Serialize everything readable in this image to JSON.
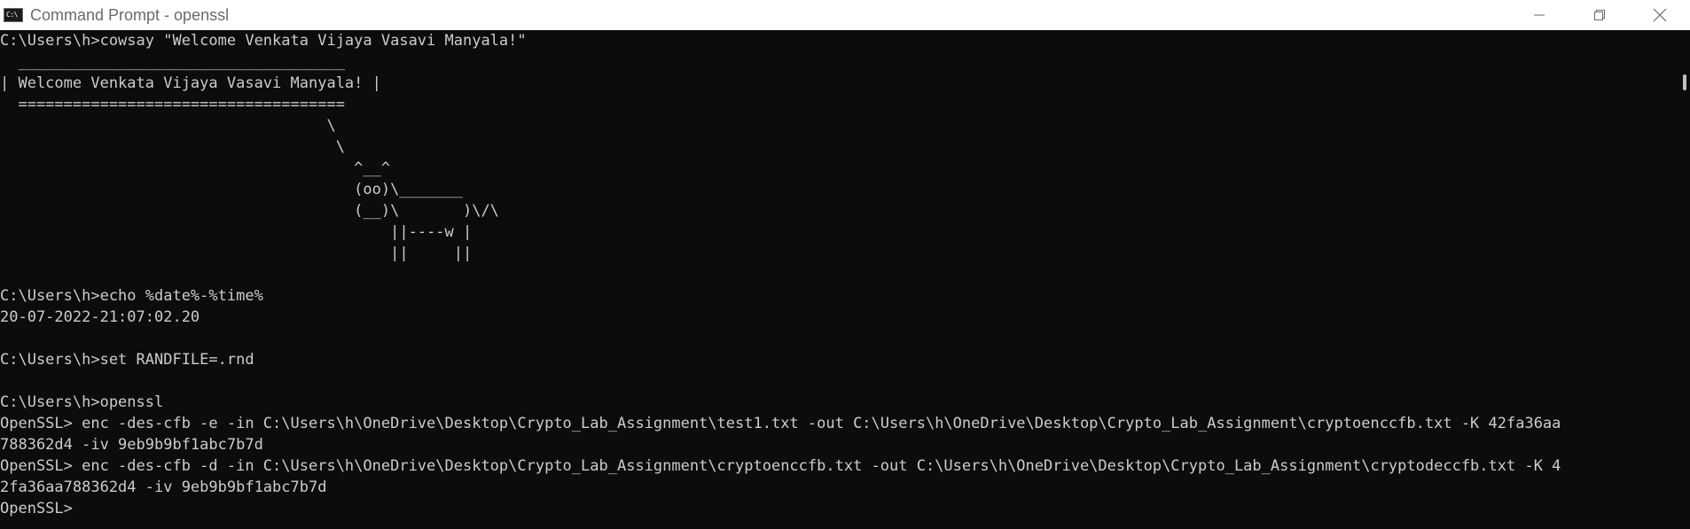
{
  "window": {
    "title": "Command Prompt - openssl",
    "icon": "C:\\",
    "controls": [
      "minimize-icon",
      "restore-icon",
      "close-icon"
    ]
  },
  "console": {
    "lines": [
      "C:\\Users\\h>cowsay \"Welcome Venkata Vijaya Vasavi Manyala!\"",
      "  ____________________________________",
      "| Welcome Venkata Vijaya Vasavi Manyala! |",
      "  ====================================",
      "                                    \\",
      "                                     \\",
      "                                       ^__^",
      "                                       (oo)\\_______",
      "                                       (__)\\       )\\/\\",
      "                                           ||----w |",
      "                                           ||     ||",
      "",
      "C:\\Users\\h>echo %date%-%time%",
      "20-07-2022-21:07:02.20",
      "",
      "C:\\Users\\h>set RANDFILE=.rnd",
      "",
      "C:\\Users\\h>openssl",
      "OpenSSL> enc -des-cfb -e -in C:\\Users\\h\\OneDrive\\Desktop\\Crypto_Lab_Assignment\\test1.txt -out C:\\Users\\h\\OneDrive\\Desktop\\Crypto_Lab_Assignment\\cryptoenccfb.txt -K 42fa36aa",
      "788362d4 -iv 9eb9b9bf1abc7b7d",
      "OpenSSL> enc -des-cfb -d -in C:\\Users\\h\\OneDrive\\Desktop\\Crypto_Lab_Assignment\\cryptoenccfb.txt -out C:\\Users\\h\\OneDrive\\Desktop\\Crypto_Lab_Assignment\\cryptodeccfb.txt -K 4",
      "2fa36aa788362d4 -iv 9eb9b9bf1abc7b7d",
      "OpenSSL>"
    ]
  },
  "colors": {
    "console_bg": "#0c0c0c",
    "console_fg": "#cccccc",
    "titlebar_bg": "#ffffff",
    "title_fg": "#6b6b6b"
  }
}
